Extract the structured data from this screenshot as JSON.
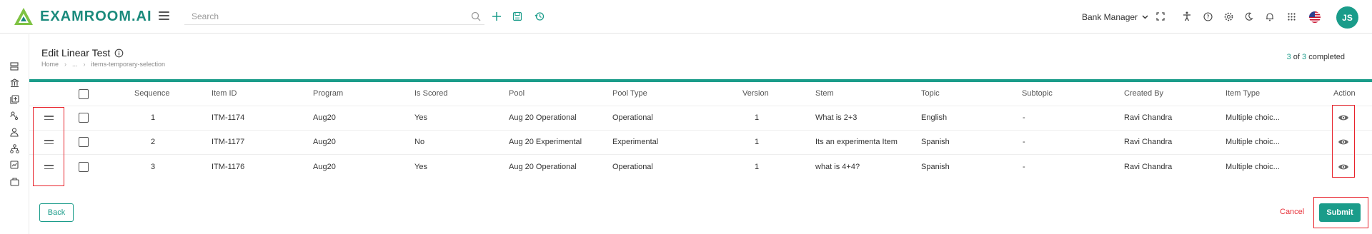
{
  "header": {
    "app_name": "EXAMROOM.AI",
    "search_placeholder": "Search",
    "role": "Bank Manager",
    "avatar_initials": "JS"
  },
  "page": {
    "title": "Edit Linear Test",
    "breadcrumb": [
      "Home",
      "...",
      "items-temporary-selection"
    ],
    "completed_count": "3",
    "total_count": "3",
    "of_label": "of",
    "completed_label": "completed",
    "progress_fraction": 1.0
  },
  "table": {
    "headers": {
      "sequence": "Sequence",
      "item_id": "Item ID",
      "program": "Program",
      "is_scored": "Is Scored",
      "pool": "Pool",
      "pool_type": "Pool Type",
      "version": "Version",
      "stem": "Stem",
      "topic": "Topic",
      "subtopic": "Subtopic",
      "created_by": "Created By",
      "item_type": "Item Type",
      "action": "Action"
    },
    "rows": [
      {
        "sequence": "1",
        "item_id": "ITM-1174",
        "program": "Aug20",
        "is_scored": "Yes",
        "pool": "Aug 20 Operational",
        "pool_type": "Operational",
        "version": "1",
        "stem": "What is 2+3",
        "topic": "English",
        "subtopic": "-",
        "created_by": "Ravi Chandra",
        "item_type": "Multiple choic..."
      },
      {
        "sequence": "2",
        "item_id": "ITM-1177",
        "program": "Aug20",
        "is_scored": "No",
        "pool": "Aug 20 Experimental",
        "pool_type": "Experimental",
        "version": "1",
        "stem": "Its an experimenta Item",
        "topic": "Spanish",
        "subtopic": "-",
        "created_by": "Ravi Chandra",
        "item_type": "Multiple choic..."
      },
      {
        "sequence": "3",
        "item_id": "ITM-1176",
        "program": "Aug20",
        "is_scored": "Yes",
        "pool": "Aug 20 Operational",
        "pool_type": "Operational",
        "version": "1",
        "stem": "what is 4+4?",
        "topic": "Spanish",
        "subtopic": "-",
        "created_by": "Ravi Chandra",
        "item_type": "Multiple choic..."
      }
    ]
  },
  "footer": {
    "back_label": "Back",
    "cancel_label": "Cancel",
    "submit_label": "Submit"
  },
  "colors": {
    "accent": "#1a9c8a",
    "danger": "#e8333b",
    "annotation": "#e8222b"
  },
  "icons": {
    "header": [
      "logo-icon",
      "menu-icon",
      "search-icon",
      "add-icon",
      "save-icon",
      "history-icon",
      "chevron-down-icon",
      "fullscreen-icon",
      "accessibility-icon",
      "help-icon",
      "settings-icon",
      "dark-mode-icon",
      "notification-icon",
      "apps-grid-icon",
      "us-flag-icon"
    ],
    "sidebar": [
      "database-icon",
      "bank-icon",
      "item-add-icon",
      "users-flow-icon",
      "user-icon",
      "hierarchy-icon",
      "chart-icon",
      "folder-icon"
    ],
    "row": [
      "drag-handle-icon",
      "eye-icon"
    ],
    "title": "info-icon"
  }
}
